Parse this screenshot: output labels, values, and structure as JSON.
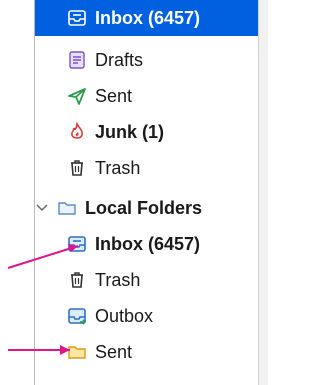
{
  "folder_pane": {
    "account_items": [
      {
        "label": "Inbox (6457)",
        "icon": "inbox-icon"
      },
      {
        "label": "Drafts",
        "icon": "drafts-icon"
      },
      {
        "label": "Sent",
        "icon": "sent-icon"
      },
      {
        "label": "Junk (1)",
        "icon": "junk-icon"
      },
      {
        "label": "Trash",
        "icon": "trash-icon"
      }
    ],
    "local_folders": {
      "label": "Local Folders",
      "items": [
        {
          "label": "Inbox (6457)",
          "icon": "inbox-icon"
        },
        {
          "label": "Trash",
          "icon": "trash-icon"
        },
        {
          "label": "Outbox",
          "icon": "outbox-icon"
        },
        {
          "label": "Sent",
          "icon": "folder-icon"
        }
      ]
    }
  },
  "colors": {
    "selection": "#0060df",
    "annotation_arrow": "#e0148c",
    "sent_green": "#2e9c4a",
    "junk_red": "#e23b3b",
    "folder_yellow": "#f5c242",
    "inbox_blue": "#2f6fc5"
  }
}
